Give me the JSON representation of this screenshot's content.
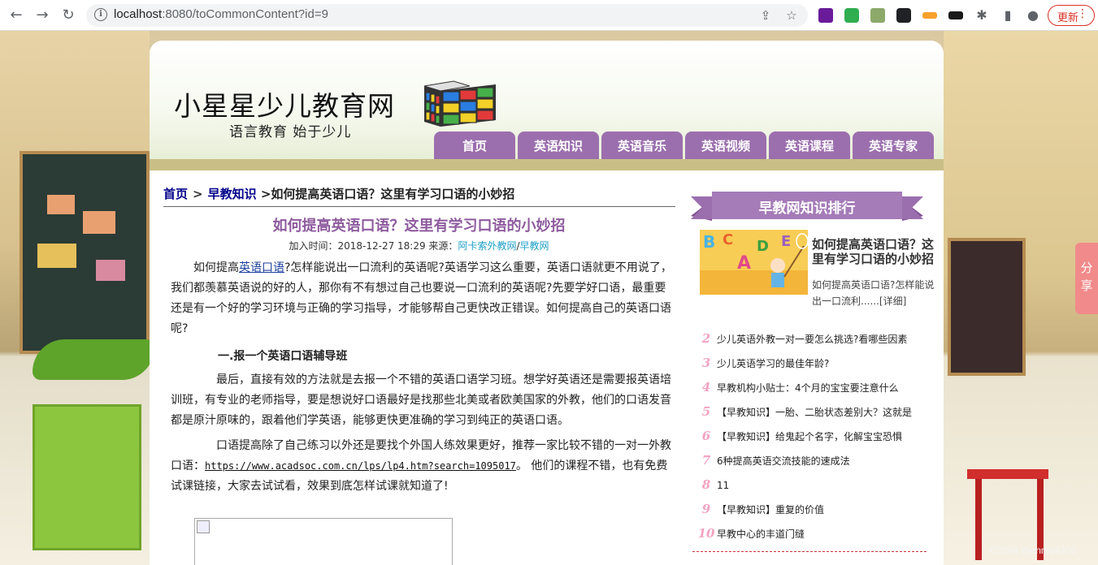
{
  "browser": {
    "url_host": "localhost",
    "url_rest": ":8080/toCommonContent?id=9",
    "update_label": "更新",
    "more_icon": "⋮"
  },
  "site": {
    "title": "小星星少儿教育网",
    "slogan": "语言教育 始于少儿",
    "nav": [
      "首页",
      "英语知识",
      "英语音乐",
      "英语视频",
      "英语课程",
      "英语专家"
    ],
    "nav_color": "#9b6fae"
  },
  "breadcrumb": {
    "home": "首页",
    "sep": ">",
    "category": "早教知识",
    "current": ">如何提高英语口语？这里有学习口语的小妙招"
  },
  "article": {
    "title": "如何提高英语口语？这里有学习口语的小妙招",
    "meta_prefix": "加入时间：2018-12-27 18:29 来源：",
    "source_1": "阿卡索外教网",
    "source_sep": "/",
    "source_2": "早教网",
    "p1_pre": "如何提高",
    "p1_kw": "英语口语",
    "p1_post": "?怎样能说出一口流利的英语呢?英语学习这么重要，英语口语就更不用说了，我们都羡慕英语说的好的人，那你有不有想过自己也要说一口流利的英语呢?先要学好口语，最重要还是有一个好的学习环境与正确的学习指导，才能够帮自己更快改正错误。如何提高自己的英语口语呢?",
    "subhead": "一.报一个英语口语辅导班",
    "p2": "最后，直接有效的方法就是去报一个不错的英语口语学习班。想学好英语还是需要报英语培训班，有专业的老师指导，要是想说好口语最好是找那些北美或者欧美国家的外教，他们的口语发音都是原汁原味的，跟着他们学英语，能够更快更准确的学习到纯正的英语口语。",
    "p3_pre": "口语提高除了自己练习以外还是要找个外国人练效果更好，推荐一家比较不错的一对一外教口语：",
    "p3_url": "https://www.acadsoc.com.cn/lps/lp4.htm?search=1095017",
    "p3_post": "。 他们的课程不错，也有免费试课链接，大家去试试看，效果到底怎样试课就知道了!"
  },
  "sidebar": {
    "heading": "早教网知识排行",
    "featured_title": "如何提高英语口语？这里有学习口语的小妙招",
    "featured_summary": "如何提高英语口语?怎样能说出一口流利......[详细]",
    "featured_image_letters": "ABCDE",
    "rank": [
      {
        "num": "2",
        "text": "少儿英语外教一对一要怎么挑选?看哪些因素"
      },
      {
        "num": "3",
        "text": "少儿英语学习的最佳年龄?"
      },
      {
        "num": "4",
        "text": "早教机构小贴士：4个月的宝宝要注意什么"
      },
      {
        "num": "5",
        "text": "【早教知识】一胎、二胎状态差别大？这就是"
      },
      {
        "num": "6",
        "text": "【早教知识】给鬼起个名字，化解宝宝恐惧"
      },
      {
        "num": "7",
        "text": "6种提高英语交流技能的速成法"
      },
      {
        "num": "8",
        "text": "11"
      },
      {
        "num": "9",
        "text": "【早教知识】重复的价值"
      },
      {
        "num": "10",
        "text": "早教中心的丰道门缝"
      }
    ],
    "rank_num_color": "#f2a3c0"
  },
  "share_tab": "分享",
  "watermark": "CSDN @anmu4200"
}
